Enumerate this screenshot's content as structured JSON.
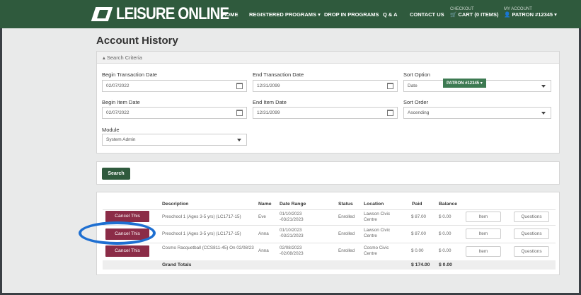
{
  "header": {
    "logo_text": "LEISURE ONLINE",
    "nav": [
      {
        "label": "HOME"
      },
      {
        "label": "REGISTERED PROGRAMS ▾"
      },
      {
        "label": "DROP IN PROGRAMS"
      },
      {
        "label": "Q & A"
      },
      {
        "label": "CONTACT US"
      }
    ],
    "checkout_label": "CHECKOUT",
    "cart_label": "CART (0 ITEMS)",
    "account_label": "MY ACCOUNT",
    "patron_label": "PATRON #12345 ▾"
  },
  "page_title": "Account History",
  "search": {
    "header": "Search Criteria",
    "begin_transaction_label": "Begin Transaction Date",
    "begin_transaction_value": "02/07/2022",
    "end_transaction_label": "End Transaction Date",
    "end_transaction_value": "12/31/2099",
    "sort_option_label": "Sort Option",
    "sort_option_value": "Date",
    "patron_pill": "PATRON #12345 ▾",
    "begin_item_label": "Begin Item Date",
    "begin_item_value": "02/07/2022",
    "end_item_label": "End Item Date",
    "end_item_value": "12/31/2099",
    "sort_order_label": "Sort Order",
    "sort_order_value": "Ascending",
    "module_label": "Module",
    "module_value": "System Admin",
    "search_button": "Search"
  },
  "table": {
    "headers": {
      "description": "Description",
      "name": "Name",
      "date_range": "Date Range",
      "status": "Status",
      "location": "Location",
      "paid": "Paid",
      "balance": "Balance"
    },
    "rows": [
      {
        "cancel": "Cancel This",
        "description": "Preschool 1 (Ages 3-5 yrs) (LC1717-15)",
        "name": "Eve",
        "date_range": "01/10/2023 -03/21/2023",
        "status": "Enrolled",
        "location": "Lawson Civic Centre",
        "paid": "$ 87.00",
        "balance": "$ 0.00",
        "item": "Item",
        "questions": "Questions"
      },
      {
        "cancel": "Cancel This",
        "description": "Preschool 1 (Ages 3-5 yrs) (LC1717-15)",
        "name": "Anna",
        "date_range": "01/10/2023 -03/21/2023",
        "status": "Enrolled",
        "location": "Lawson Civic Centre",
        "paid": "$ 87.00",
        "balance": "$ 0.00",
        "item": "Item",
        "questions": "Questions"
      },
      {
        "cancel": "Cancel This",
        "description": "Cosmo Racquetball (CCS811-45) On 02/08/23",
        "name": "Anna",
        "date_range": "02/08/2023 -02/08/2023",
        "status": "Enrolled",
        "location": "Cosmo Civic Centre",
        "paid": "$ 0.00",
        "balance": "$ 0.00",
        "item": "Item",
        "questions": "Questions"
      }
    ],
    "totals_label": "Grand Totals",
    "totals_paid": "$ 174.00",
    "totals_balance": "$ 0.00"
  },
  "colors": {
    "brand_green": "#2f5a3d",
    "cancel_maroon": "#8b2c47",
    "highlight_blue": "#1e6fd1"
  }
}
